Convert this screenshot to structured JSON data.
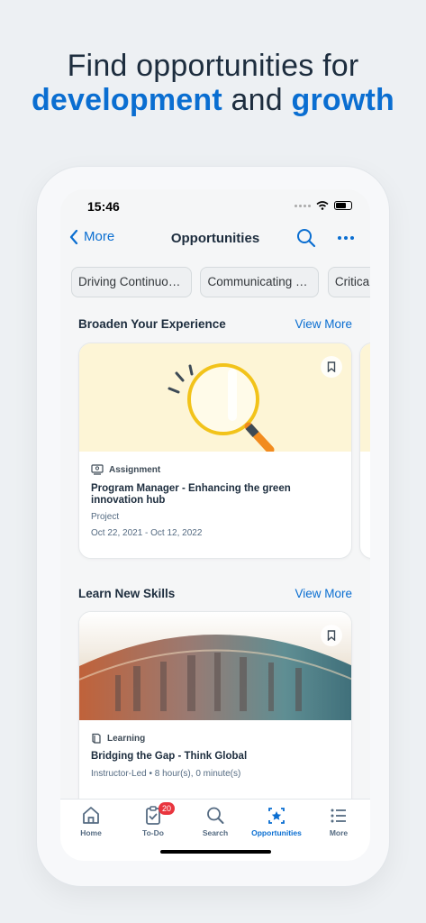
{
  "headline": {
    "line1": "Find opportunities for",
    "accent1": "development",
    "joiner": "and",
    "accent2": "growth"
  },
  "status_bar": {
    "time": "15:46"
  },
  "navbar": {
    "back_label": "More",
    "title": "Opportunities",
    "search_icon": "search-icon",
    "more_icon": "ellipsis-icon"
  },
  "chips": [
    {
      "label": "Driving Continuou..."
    },
    {
      "label": "Communicating E..."
    },
    {
      "label": "Critical T"
    }
  ],
  "sections": [
    {
      "title": "Broaden Your Experience",
      "view_more": "View More",
      "card": {
        "type": "Assignment",
        "type_icon": "assignment-icon",
        "title": "Program Manager - Enhancing the green innovation hub",
        "subtitle": "Project",
        "dates": "Oct 22, 2021 - Oct 12, 2022",
        "image": "magnifying-glass-illustration",
        "image_bg": "#fdf5d6"
      }
    },
    {
      "title": "Learn New Skills",
      "view_more": "View More",
      "card": {
        "type": "Learning",
        "type_icon": "book-icon",
        "title": "Bridging the Gap - Think Global",
        "subtitle": "Instructor-Led • 8 hour(s), 0 minute(s)",
        "image": "city-globe-photo"
      }
    }
  ],
  "tabbar": {
    "items": [
      {
        "label": "Home",
        "icon": "home-icon"
      },
      {
        "label": "To-Do",
        "icon": "todo-icon",
        "badge": "20"
      },
      {
        "label": "Search",
        "icon": "search-icon"
      },
      {
        "label": "Opportunities",
        "icon": "opportunities-icon",
        "active": true
      },
      {
        "label": "More",
        "icon": "list-icon"
      }
    ]
  },
  "colors": {
    "accent": "#0a6ed1",
    "text": "#1d2d3e",
    "badge": "#e9353e",
    "background": "#edf0f3"
  }
}
